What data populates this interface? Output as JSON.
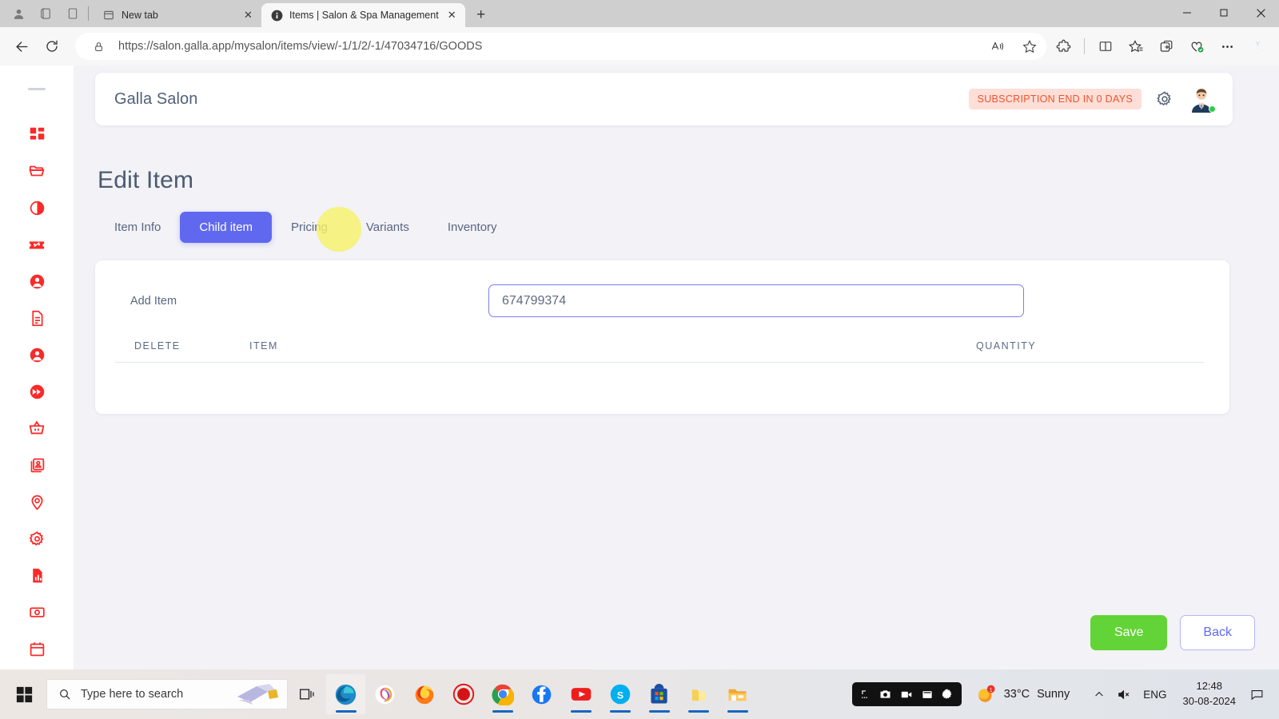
{
  "browser": {
    "system_icons": [
      "profile-icon",
      "workspaces-icon",
      "tab-actions-icon"
    ],
    "tabs": [
      {
        "title": "New tab",
        "favicon": "new-tab-icon",
        "active": false
      },
      {
        "title": "Items | Salon & Spa Management",
        "favicon": "salon-app-favicon",
        "active": true
      }
    ],
    "new_tab_label": "+",
    "close_label": "✕",
    "window_controls": {
      "minimize": "—",
      "maximize": "❐",
      "close": "✕"
    },
    "nav": {
      "back": "back-arrow",
      "reload": "reload-icon"
    },
    "address": {
      "lock_icon": "lock-icon",
      "url_prefix": "https://",
      "url_domain": "salon.galla.app",
      "url_path": "/mysalon/items/view/-1/1/2/-1/47034716/GOODS",
      "full_url": "https://salon.galla.app/mysalon/items/view/-1/1/2/-1/47034716/GOODS",
      "read_aloud": "read-aloud-icon",
      "favorite": "star-icon"
    },
    "toolbar_icons": [
      "extensions-icon",
      "split-screen-icon",
      "favorites-icon",
      "collections-icon",
      "browser-essentials-icon",
      "settings-more-icon",
      "copilot-icon"
    ]
  },
  "sidebar": {
    "collapse_handle": "drag-handle",
    "items": [
      {
        "icon": "dashboard-icon"
      },
      {
        "icon": "folder-icon"
      },
      {
        "icon": "contrast-circle-icon"
      },
      {
        "icon": "discount-ticket-icon"
      },
      {
        "icon": "user-circle-icon"
      },
      {
        "icon": "document-icon"
      },
      {
        "icon": "user-circle-icon-2"
      },
      {
        "icon": "fast-forward-icon"
      },
      {
        "icon": "basket-icon"
      },
      {
        "icon": "id-card-icon"
      },
      {
        "icon": "location-pin-icon"
      },
      {
        "icon": "gear-icon"
      },
      {
        "icon": "report-chart-icon"
      },
      {
        "icon": "cash-icon"
      },
      {
        "icon": "calendar-icon"
      }
    ]
  },
  "header": {
    "brand": "Galla Salon",
    "subscription_badge": "SUBSCRIPTION END IN 0 DAYS",
    "subscription_badge_color": "#f2512c",
    "subscription_badge_bg": "#fddfd7",
    "settings_icon": "gear-icon",
    "avatar": "user-avatar",
    "avatar_status": "online"
  },
  "main": {
    "page_title": "Edit Item",
    "tabs": [
      {
        "label": "Item Info",
        "active": false
      },
      {
        "label": "Child item",
        "active": true
      },
      {
        "label": "Pricing",
        "active": false
      },
      {
        "label": "Variants",
        "active": false
      },
      {
        "label": "Inventory",
        "active": false
      }
    ],
    "active_tab_color": "#6168f0",
    "click_indicator": "yellow-click-highlight",
    "form": {
      "add_item_label": "Add Item",
      "add_item_value": "674799374",
      "add_item_placeholder": "Add Item"
    },
    "table": {
      "columns": [
        "DELETE",
        "ITEM",
        "QUANTITY"
      ],
      "rows": []
    },
    "actions": {
      "save_label": "Save",
      "save_color": "#63d437",
      "back_label": "Back",
      "back_color": "#6168f0"
    }
  },
  "taskbar": {
    "start_icon": "windows-start-icon",
    "search_placeholder": "Type here to search",
    "search_icon": "search-icon",
    "task_view_icon": "task-view-icon",
    "apps": [
      {
        "name": "edge-icon",
        "running": true
      },
      {
        "name": "copilot-icon",
        "running": false
      },
      {
        "name": "firefox-icon",
        "running": false
      },
      {
        "name": "screen-recorder-icon",
        "running": false
      },
      {
        "name": "chrome-icon",
        "running": true
      },
      {
        "name": "facebook-icon",
        "running": false
      },
      {
        "name": "youtube-icon",
        "running": true
      },
      {
        "name": "skype-icon",
        "running": true
      },
      {
        "name": "microsoft-store-icon",
        "running": true
      },
      {
        "name": "folder-yellow-icon",
        "running": true
      },
      {
        "name": "file-explorer-icon",
        "running": true
      }
    ],
    "recorder_bar": [
      "screenshot-icon",
      "camera-icon",
      "video-icon",
      "window-icon",
      "settings-icon"
    ],
    "weather": {
      "icon": "sunny-icon",
      "badge": "1",
      "temperature": "33°C",
      "condition": "Sunny"
    },
    "tray": {
      "chevron": "show-hidden-icons",
      "volume": "volume-muted-icon",
      "language": "ENG"
    },
    "clock": {
      "time": "12:48",
      "date": "30-08-2024"
    },
    "notification_icon": "notification-center-icon"
  }
}
